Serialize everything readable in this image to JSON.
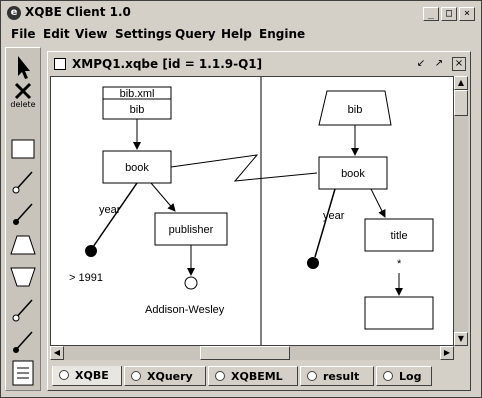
{
  "window": {
    "title": "XQBE Client 1.0",
    "icon": "e"
  },
  "window_controls": {
    "minimize": "_",
    "maximize": "□",
    "close": "×"
  },
  "menu": [
    "File",
    "Edit",
    "View",
    "Settings",
    "Query",
    "Help",
    "Engine"
  ],
  "tools": [
    {
      "name": "pointer-tool",
      "icon": "arrow-pointer-icon"
    },
    {
      "name": "delete-tool",
      "icon": "x-icon",
      "label": "delete"
    },
    {
      "name": "rectangle-tool",
      "icon": "rectangle-icon"
    },
    {
      "name": "arc-tool-1",
      "icon": "arc-icon"
    },
    {
      "name": "arc-tool-2",
      "icon": "arc-filled-icon"
    },
    {
      "name": "trapezoid-tool",
      "icon": "trapezoid-icon"
    },
    {
      "name": "inverted-trapezoid-tool",
      "icon": "inverted-trapezoid-icon"
    },
    {
      "name": "arc-tool-3",
      "icon": "arc-icon"
    },
    {
      "name": "arc-tool-4",
      "icon": "arc-filled-icon"
    },
    {
      "name": "list-tool",
      "icon": "list-icon"
    }
  ],
  "internal_frame": {
    "title": "XMPQ1.xqbe [id = 1.1.9-Q1]"
  },
  "source": {
    "doc": "bib.xml",
    "root": "bib",
    "book": "book",
    "year_label": "year",
    "year_value": "> 1991",
    "publisher": "publisher",
    "publisher_value": "Addison-Wesley"
  },
  "construct": {
    "root": "bib",
    "book": "book",
    "year_label": "year",
    "title": "title",
    "star": "*"
  },
  "tabs": [
    "XQBE",
    "XQuery",
    "XQBEML",
    "result",
    "Log"
  ],
  "active_tab": "XQBE"
}
